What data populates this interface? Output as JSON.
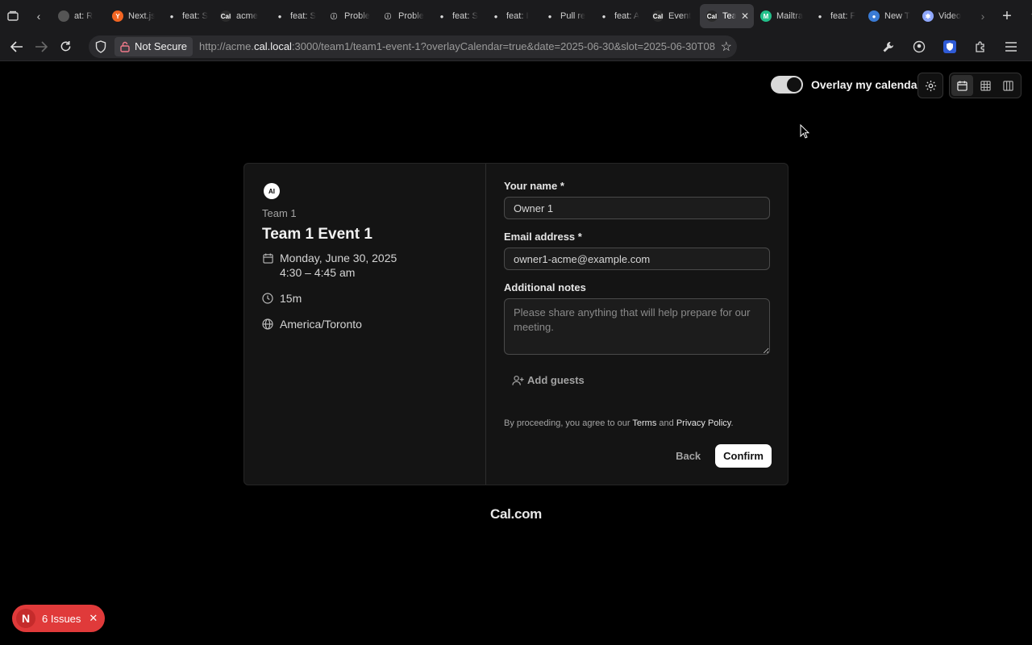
{
  "browser": {
    "tabs": [
      {
        "label": "at: R",
        "favicon": "generic"
      },
      {
        "label": "Next.js",
        "favicon": "y-combinator-icon"
      },
      {
        "label": "feat: S",
        "favicon": "github-icon"
      },
      {
        "label": "acme",
        "favicon": "cal-icon"
      },
      {
        "label": "feat: S",
        "favicon": "github-icon"
      },
      {
        "label": "Proble",
        "favicon": "info-icon"
      },
      {
        "label": "Proble",
        "favicon": "info-icon"
      },
      {
        "label": "feat: S",
        "favicon": "github-icon"
      },
      {
        "label": "feat: I",
        "favicon": "github-icon"
      },
      {
        "label": "Pull re",
        "favicon": "github-icon"
      },
      {
        "label": "feat: A",
        "favicon": "github-icon"
      },
      {
        "label": "Event",
        "favicon": "cal-icon"
      },
      {
        "label": "Tea",
        "favicon": "cal-icon",
        "active": true
      },
      {
        "label": "Mailtra",
        "favicon": "mailtrap-icon"
      },
      {
        "label": "feat: F",
        "favicon": "github-icon"
      },
      {
        "label": "New T",
        "favicon": "firefox-icon"
      },
      {
        "label": "Video",
        "favicon": "video-icon"
      }
    ],
    "security_label": "Not Secure",
    "url_prefix": "http://acme.",
    "url_host": "cal.local",
    "url_rest": ":3000/team1/team1-event-1?overlayCalendar=true&date=2025-06-30&slot=2025-06-30T08"
  },
  "header": {
    "overlay_label": "Overlay my calendar",
    "overlay_on": true
  },
  "event": {
    "avatar_text": "AI",
    "team_name": "Team 1",
    "title": "Team 1 Event 1",
    "date": "Monday, June 30, 2025",
    "time": "4:30 – 4:45 am",
    "duration": "15m",
    "timezone": "America/Toronto"
  },
  "form": {
    "name_label": "Your name *",
    "name_value": "Owner 1",
    "email_label": "Email address *",
    "email_value": "owner1-acme@example.com",
    "notes_label": "Additional notes",
    "notes_placeholder": "Please share anything that will help prepare for our meeting.",
    "add_guests": "Add guests",
    "legal_prefix": "By proceeding, you agree to our ",
    "terms": "Terms",
    "legal_and": " and ",
    "privacy": "Privacy Policy",
    "legal_suffix": ".",
    "back_label": "Back",
    "confirm_label": "Confirm"
  },
  "footer": {
    "brand": "Cal.com"
  },
  "dev_badge": {
    "letter": "N",
    "issues": "6 Issues"
  },
  "colors": {
    "background": "#000000",
    "card": "#141414",
    "issues_badge": "#e03a3a"
  }
}
